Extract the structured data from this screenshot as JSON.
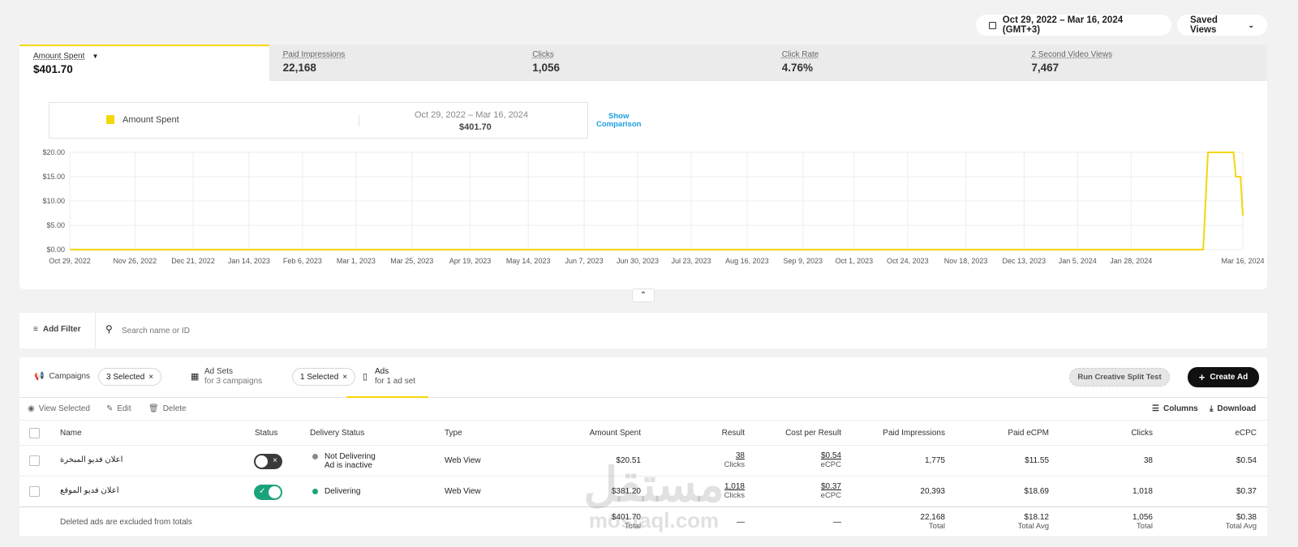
{
  "header": {
    "date_range": "Oct 29, 2022 – Mar 16, 2024 (GMT+3)",
    "saved_views": "Saved Views"
  },
  "metrics": [
    {
      "label": "Amount Spent",
      "value": "$401.70"
    },
    {
      "label": "Paid Impressions",
      "value": "22,168"
    },
    {
      "label": "Clicks",
      "value": "1,056"
    },
    {
      "label": "Click Rate",
      "value": "4.76%"
    },
    {
      "label": "2 Second Video Views",
      "value": "7,467"
    }
  ],
  "legend": {
    "series_name": "Amount Spent",
    "range": "Oct 29, 2022 – Mar 16, 2024",
    "total": "$401.70",
    "show_comparison_line1": "Show",
    "show_comparison_line2": "Comparison"
  },
  "colors": {
    "series": "#f5d60a",
    "accent_blue": "#1aa0e0",
    "toggle_on": "#1aa37a",
    "toggle_off": "#3a3a3a",
    "delivering": "#1aa37a",
    "not_delivering": "#8a8a8a"
  },
  "chart_data": {
    "type": "line",
    "ylim": [
      0,
      20
    ],
    "y_ticks": [
      "$0.00",
      "$5.00",
      "$10.00",
      "$15.00",
      "$20.00"
    ],
    "x_ticks": [
      "Oct 29, 2022",
      "Nov 26, 2022",
      "Dec 21, 2022",
      "Jan 14, 2023",
      "Feb 6, 2023",
      "Mar 1, 2023",
      "Mar 25, 2023",
      "Apr 19, 2023",
      "May 14, 2023",
      "Jun 7, 2023",
      "Jun 30, 2023",
      "Jul 23, 2023",
      "Aug 16, 2023",
      "Sep 9, 2023",
      "Oct 1, 2023",
      "Oct 24, 2023",
      "Nov 18, 2023",
      "Dec 13, 2023",
      "Jan 5, 2024",
      "Jan 28, 2024",
      "Mar 16, 2024"
    ],
    "series": [
      {
        "name": "Amount Spent",
        "x": [
          "Oct 29, 2022",
          "Feb 28, 2024",
          "Mar 1, 2024",
          "Mar 12, 2024",
          "Mar 13, 2024",
          "Mar 15, 2024",
          "Mar 16, 2024"
        ],
        "values": [
          0,
          0,
          20,
          20,
          15,
          15,
          7
        ]
      }
    ]
  },
  "filter_bar": {
    "add_filter": "Add Filter",
    "search_placeholder": "Search name or ID"
  },
  "levels": {
    "campaigns": "Campaigns",
    "campaigns_chip": "3 Selected",
    "adsets": "Ad Sets",
    "adsets_sub": "for 3 campaigns",
    "adsets_chip": "1 Selected",
    "ads": "Ads",
    "ads_sub": "for 1 ad set"
  },
  "actions": {
    "split_test": "Run Creative Split Test",
    "create_ad": "Create Ad",
    "view_selected": "View Selected",
    "edit": "Edit",
    "delete": "Delete",
    "columns": "Columns",
    "download": "Download"
  },
  "table": {
    "headers": {
      "name": "Name",
      "status": "Status",
      "delivery": "Delivery Status",
      "type": "Type",
      "spent": "Amount Spent",
      "result": "Result",
      "cpr": "Cost per Result",
      "impr": "Paid Impressions",
      "ecpm": "Paid eCPM",
      "clicks": "Clicks",
      "ecpc": "eCPC"
    },
    "rows": [
      {
        "name": "اعلان فديو المبخرة",
        "delivery1": "Not Delivering",
        "delivery2": "Ad is inactive",
        "type": "Web View",
        "spent": "$20.51",
        "result": "38",
        "result_sub": "Clicks",
        "cpr": "$0.54",
        "cpr_sub": "eCPC",
        "impr": "1,775",
        "ecpm": "$11.55",
        "clicks": "38",
        "ecpc": "$0.54"
      },
      {
        "name": "اعلان فديو الموقع",
        "delivery1": "Delivering",
        "type": "Web View",
        "spent": "$381.20",
        "result": "1,018",
        "result_sub": "Clicks",
        "cpr": "$0.37",
        "cpr_sub": "eCPC",
        "impr": "20,393",
        "ecpm": "$18.69",
        "clicks": "1,018",
        "ecpc": "$0.37"
      }
    ],
    "totals": {
      "note": "Deleted ads are excluded from totals",
      "spent": "$401.70",
      "spent_sub": "Total",
      "result": "—",
      "cpr": "—",
      "impr": "22,168",
      "impr_sub": "Total",
      "ecpm": "$18.12",
      "ecpm_sub": "Total Avg",
      "clicks": "1,056",
      "clicks_sub": "Total",
      "ecpc": "$0.38",
      "ecpc_sub": "Total Avg"
    }
  },
  "watermark": {
    "arabic": "مستقل",
    "latin": "mostaql.com"
  }
}
